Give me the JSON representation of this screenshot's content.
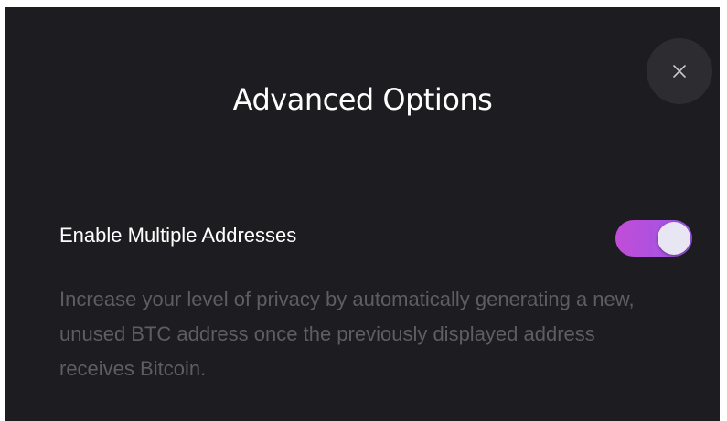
{
  "modal": {
    "title": "Advanced Options",
    "close_icon": "close-icon"
  },
  "option": {
    "label": "Enable Multiple Addresses",
    "enabled": true,
    "description": "Increase your level of privacy by automatically generating a new, unused BTC address once the previously displayed address receives Bitcoin."
  },
  "colors": {
    "background": "#1d1d21",
    "toggle_on_start": "#c24dd8",
    "toggle_on_end": "#9b56e6",
    "description_text": "#5d5d62"
  }
}
